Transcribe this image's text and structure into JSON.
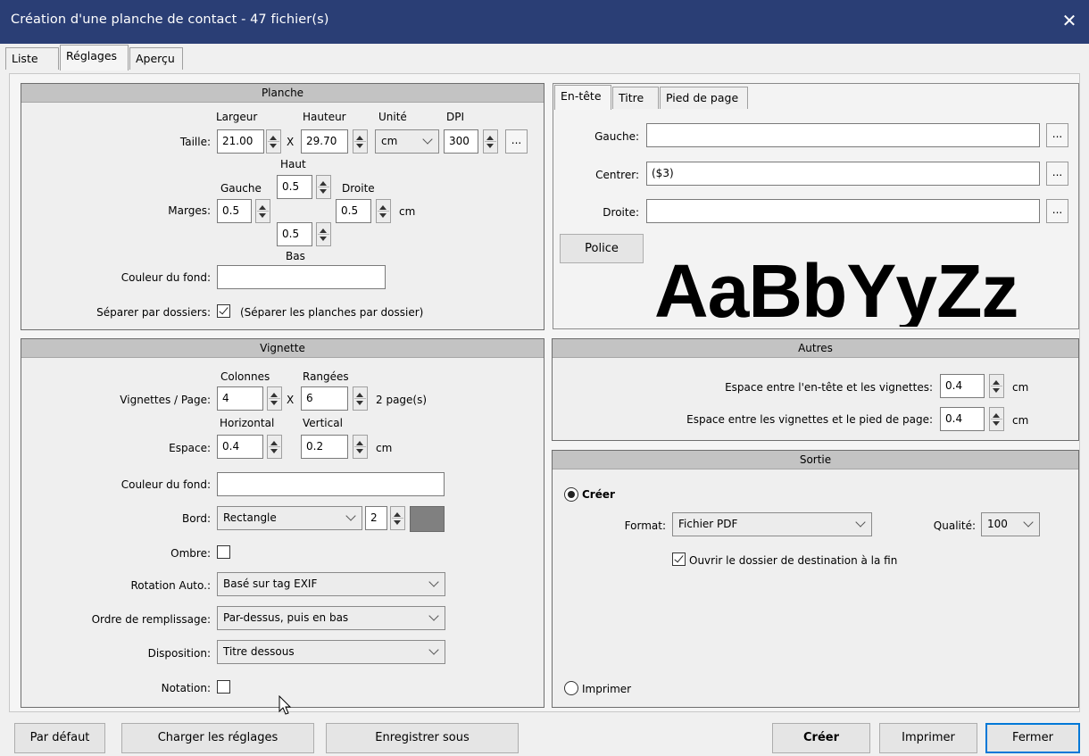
{
  "window": {
    "title": "Création d'une planche de contact - 47 fichier(s)",
    "close_icon": "close-icon"
  },
  "tabs": [
    "Liste",
    "Réglages",
    "Aperçu"
  ],
  "planche": {
    "title": "Planche",
    "taille_label": "Taille:",
    "largeur_label": "Largeur",
    "hauteur_label": "Hauteur",
    "unite_label": "Unité",
    "dpi_label": "DPI",
    "largeur": "21.00",
    "x": "X",
    "hauteur": "29.70",
    "unite": "cm",
    "dpi": "300",
    "dots": "...",
    "marges_label": "Marges:",
    "haut_label": "Haut",
    "gauche_label": "Gauche",
    "droite_label": "Droite",
    "bas_label": "Bas",
    "marge_haut": "0.5",
    "marge_gauche": "0.5",
    "marge_droite": "0.5",
    "marge_bas": "0.5",
    "marge_unit": "cm",
    "couleur_label": "Couleur du fond:",
    "separer_label": "Séparer par dossiers:",
    "separer_text": "(Séparer les planches par dossier)",
    "separer_checked": true
  },
  "header_tabs": [
    "En-tête",
    "Titre",
    "Pied de page"
  ],
  "entete": {
    "gauche_label": "Gauche:",
    "gauche_value": "",
    "centrer_label": "Centrer:",
    "centrer_value": "($3)",
    "droite_label": "Droite:",
    "droite_value": "",
    "dots": "...",
    "police_label": "Police",
    "sample": "AaBbYyZz"
  },
  "vignette": {
    "title": "Vignette",
    "colonnes_label": "Colonnes",
    "rangees_label": "Rangées",
    "vpp_label": "Vignettes / Page:",
    "colonnes": "4",
    "x": "X",
    "rangees": "6",
    "pages": "2 page(s)",
    "horizontal_label": "Horizontal",
    "vertical_label": "Vertical",
    "espace_label": "Espace:",
    "espace_h": "0.4",
    "espace_v": "0.2",
    "espace_unit": "cm",
    "couleur_label": "Couleur du fond:",
    "bord_label": "Bord:",
    "bord_value": "Rectangle",
    "bord_width": "2",
    "bord_color": "#808080",
    "ombre_label": "Ombre:",
    "rotation_label": "Rotation Auto.:",
    "rotation_value": "Basé sur tag EXIF",
    "ordre_label": "Ordre de remplissage:",
    "ordre_value": "Par-dessus, puis en bas",
    "disposition_label": "Disposition:",
    "disposition_value": "Titre dessous",
    "notation_label": "Notation:"
  },
  "autres": {
    "title": "Autres",
    "espace_entete_label": "Espace entre l'en-tête et les vignettes:",
    "espace_entete": "0.4",
    "espace_pied_label": "Espace entre les vignettes et le pied de page:",
    "espace_pied": "0.4",
    "unit": "cm"
  },
  "sortie": {
    "title": "Sortie",
    "creer_label": "Créer",
    "format_label": "Format:",
    "format_value": "Fichier PDF",
    "qualite_label": "Qualité:",
    "qualite_value": "100",
    "ouvrir_label": "Ouvrir le dossier de destination à la fin",
    "imprimer_label": "Imprimer"
  },
  "footer": {
    "par_defaut": "Par défaut",
    "charger": "Charger les réglages",
    "enregistrer": "Enregistrer sous",
    "creer": "Créer",
    "imprimer": "Imprimer",
    "fermer": "Fermer"
  },
  "colors": {
    "titlebar": "#2a3e75",
    "group_header": "#c3c3c3",
    "accent": "#0078d7"
  }
}
